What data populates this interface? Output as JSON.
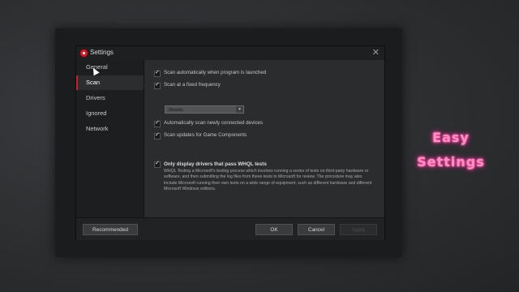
{
  "window": {
    "title": "Settings",
    "close_glyph": "✕"
  },
  "sidebar": {
    "items": [
      {
        "label": "General"
      },
      {
        "label": "Scan",
        "active": true
      },
      {
        "label": "Drivers"
      },
      {
        "label": "Ignored"
      },
      {
        "label": "Network"
      }
    ]
  },
  "scan": {
    "options": [
      {
        "label": "Scan automatically when program is launched",
        "checked": true
      },
      {
        "label": "Scan at a fixed frequency",
        "checked": true
      },
      {
        "label": "Automatically scan newly connected devices",
        "checked": true
      },
      {
        "label": "Scan updates for Game Components",
        "checked": true
      }
    ],
    "frequency_select": {
      "value": "Weekly"
    },
    "whql": {
      "label": "Only display drivers that pass WHQL tests",
      "checked": true,
      "description": "WHQL Testing a Microsoft's testing process which involves running a series of tests on third-party hardware or software, and then submitting the log files from these tests to Microsoft for review. The procedure may also include Microsoft running their own tests on a wide range of equipment, such as different hardware and different Microsoft Windows editions."
    }
  },
  "footer": {
    "recommended_label": "Recommended",
    "ok_label": "OK",
    "cancel_label": "Cancel",
    "apply_label": "Apply"
  },
  "promo": {
    "line1": "Easy",
    "line2": "Settings"
  },
  "colors": {
    "accent": "#c8202a",
    "promo": "#ff90c0"
  }
}
